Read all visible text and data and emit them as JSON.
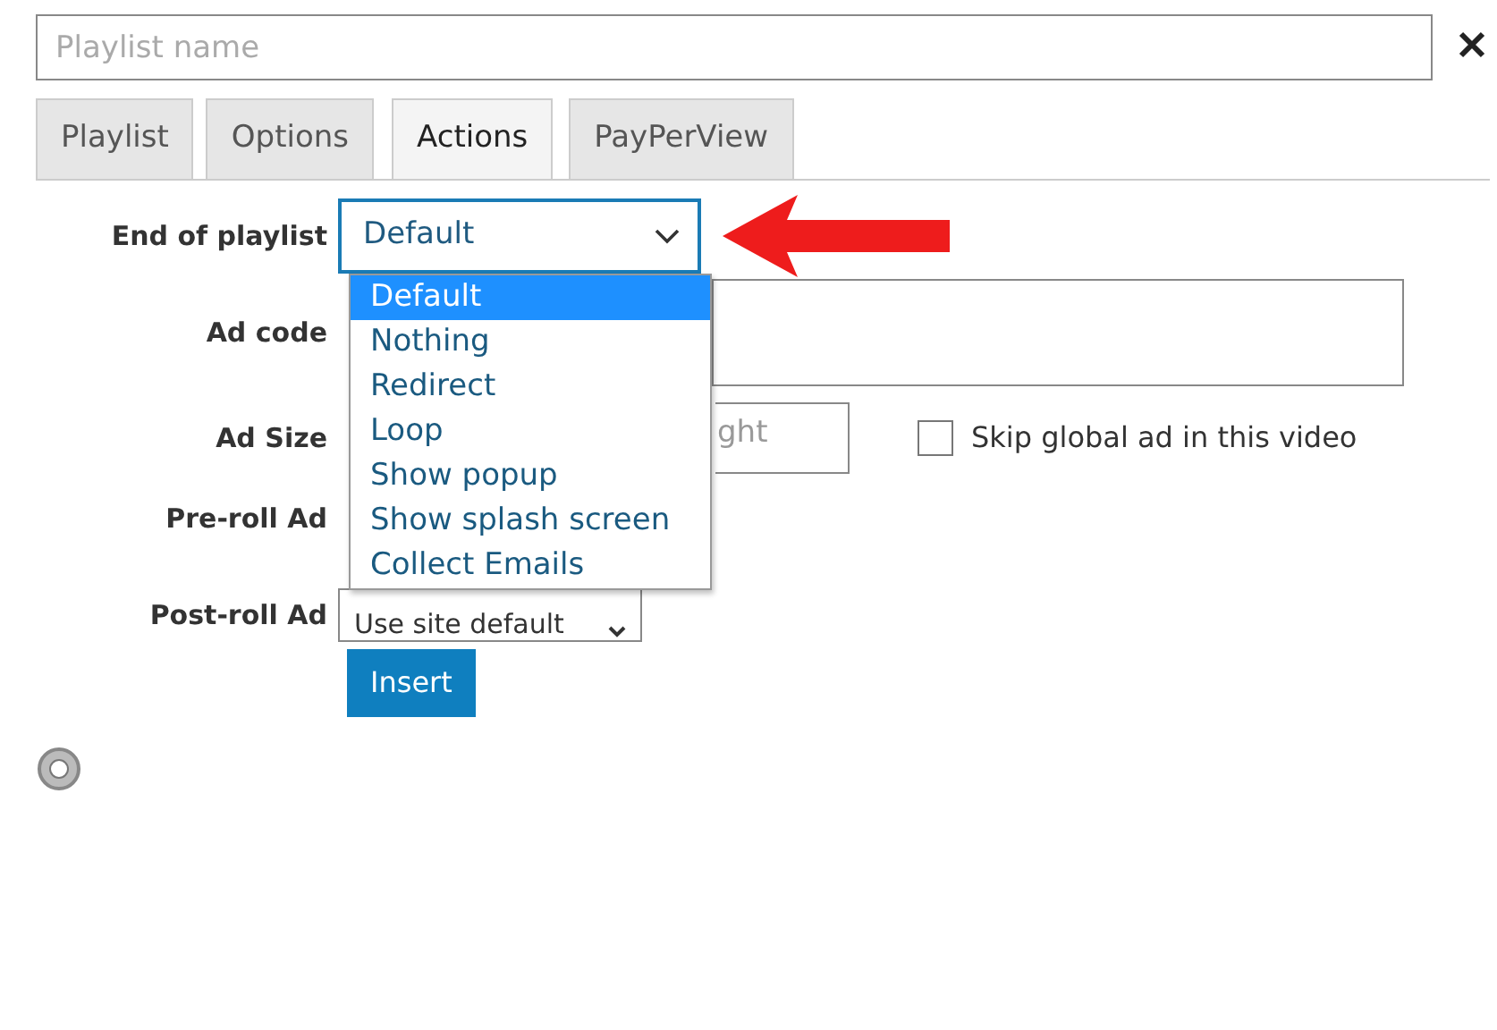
{
  "name_field": {
    "placeholder": "Playlist name"
  },
  "tabs": [
    {
      "label": "Playlist",
      "selected": false
    },
    {
      "label": "Options",
      "selected": false
    },
    {
      "label": "Actions",
      "selected": true
    },
    {
      "label": "PayPerView",
      "selected": false
    }
  ],
  "end_of_playlist": {
    "label": "End of playlist",
    "value": "Default",
    "expanded": true,
    "options": [
      {
        "label": "Default",
        "selected": true
      },
      {
        "label": "Nothing",
        "selected": false
      },
      {
        "label": "Redirect",
        "selected": false
      },
      {
        "label": "Loop",
        "selected": false
      },
      {
        "label": "Show popup",
        "selected": false
      },
      {
        "label": "Show splash screen",
        "selected": false
      },
      {
        "label": "Collect Emails",
        "selected": false
      }
    ]
  },
  "ad_code": {
    "label": "Ad code"
  },
  "ad_size": {
    "label": "Ad Size",
    "height_placeholder": "ght"
  },
  "skip_global_ad": {
    "label": "Skip global ad in this video",
    "checked": false
  },
  "pre_roll": {
    "label": "Pre-roll Ad"
  },
  "post_roll": {
    "label": "Post-roll Ad",
    "value": "Use site default"
  },
  "insert_button": "Insert"
}
